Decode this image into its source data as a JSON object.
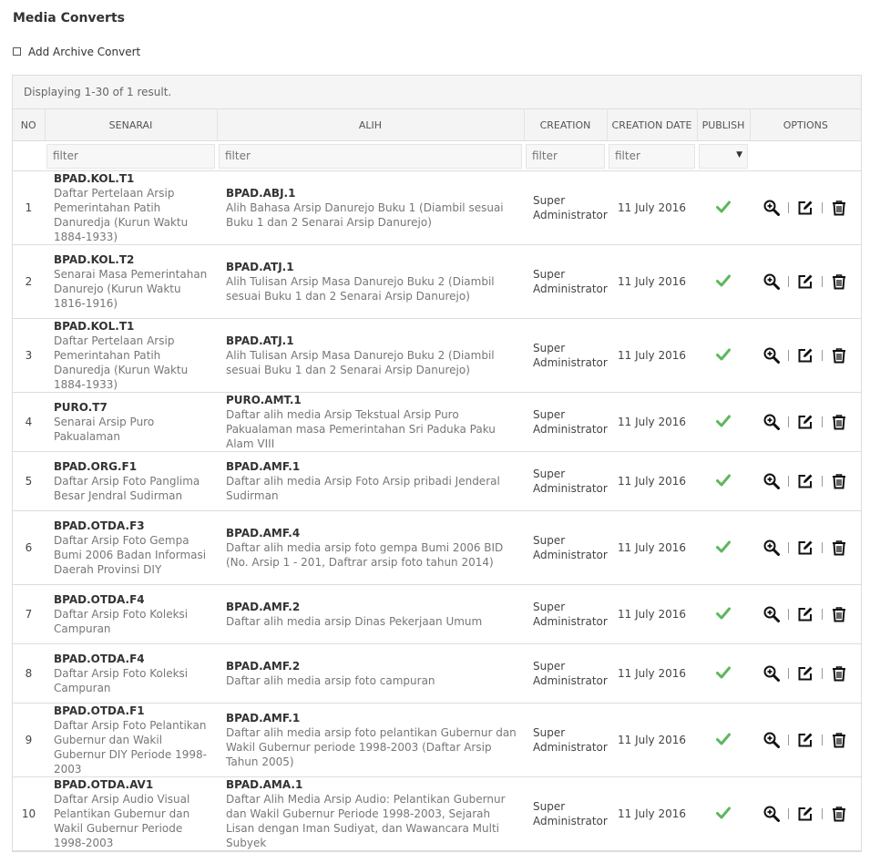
{
  "page": {
    "title": "Media Converts",
    "add_link": "Add Archive Convert"
  },
  "grid": {
    "summary": "Displaying 1-30 of 1 result.",
    "columns": [
      "NO",
      "SENARAI",
      "ALIH",
      "CREATION",
      "CREATION DATE",
      "PUBLISH",
      "OPTIONS"
    ],
    "filter_placeholder": "filter",
    "rows": [
      {
        "no": "1",
        "senarai_code": "BPAD.KOL.T1",
        "senarai_desc": "Daftar Pertelaan Arsip Pemerintahan Patih Danuredja (Kurun Waktu 1884-1933)",
        "alih_code": "BPAD.ABJ.1",
        "alih_desc": "Alih Bahasa Arsip Danurejo Buku 1 (Diambil sesuai Buku 1 dan 2 Senarai Arsip Danurejo)",
        "creation": "Super Administrator",
        "date": "11 July 2016"
      },
      {
        "no": "2",
        "senarai_code": "BPAD.KOL.T2",
        "senarai_desc": "Senarai Masa Pemerintahan Danurejo (Kurun Waktu 1816-1916)",
        "alih_code": "BPAD.ATJ.1",
        "alih_desc": "Alih Tulisan Arsip Masa Danurejo Buku 2 (Diambil sesuai Buku 1 dan 2 Senarai Arsip Danurejo)",
        "creation": "Super Administrator",
        "date": "11 July 2016"
      },
      {
        "no": "3",
        "senarai_code": "BPAD.KOL.T1",
        "senarai_desc": "Daftar Pertelaan Arsip Pemerintahan Patih Danuredja (Kurun Waktu 1884-1933)",
        "alih_code": "BPAD.ATJ.1",
        "alih_desc": "Alih Tulisan Arsip Masa Danurejo Buku 2 (Diambil sesuai Buku 1 dan 2 Senarai Arsip Danurejo)",
        "creation": "Super Administrator",
        "date": "11 July 2016"
      },
      {
        "no": "4",
        "senarai_code": "PURO.T7",
        "senarai_desc": "Senarai Arsip Puro Pakualaman",
        "alih_code": "PURO.AMT.1",
        "alih_desc": "Daftar alih media Arsip Tekstual Arsip Puro Pakualaman masa Pemerintahan Sri Paduka Paku Alam VIII",
        "creation": "Super Administrator",
        "date": "11 July 2016"
      },
      {
        "no": "5",
        "senarai_code": "BPAD.ORG.F1",
        "senarai_desc": "Daftar Arsip Foto Panglima Besar Jendral Sudirman",
        "alih_code": "BPAD.AMF.1",
        "alih_desc": "Daftar alih media Arsip Foto Arsip pribadi Jenderal Sudirman",
        "creation": "Super Administrator",
        "date": "11 July 2016"
      },
      {
        "no": "6",
        "senarai_code": "BPAD.OTDA.F3",
        "senarai_desc": "Daftar Arsip Foto Gempa Bumi 2006 Badan Informasi Daerah Provinsi DIY",
        "alih_code": "BPAD.AMF.4",
        "alih_desc": "Daftar alih media arsip foto gempa Bumi 2006 BID (No. Arsip 1 - 201, Daftrar arsip foto tahun 2014)",
        "creation": "Super Administrator",
        "date": "11 July 2016"
      },
      {
        "no": "7",
        "senarai_code": "BPAD.OTDA.F4",
        "senarai_desc": "Daftar Arsip Foto Koleksi Campuran",
        "alih_code": "BPAD.AMF.2",
        "alih_desc": "Daftar alih media arsip Dinas Pekerjaan Umum",
        "creation": "Super Administrator",
        "date": "11 July 2016"
      },
      {
        "no": "8",
        "senarai_code": "BPAD.OTDA.F4",
        "senarai_desc": "Daftar Arsip Foto Koleksi Campuran",
        "alih_code": "BPAD.AMF.2",
        "alih_desc": "Daftar alih media arsip foto campuran",
        "creation": "Super Administrator",
        "date": "11 July 2016"
      },
      {
        "no": "9",
        "senarai_code": "BPAD.OTDA.F1",
        "senarai_desc": "Daftar Arsip Foto Pelantikan Gubernur dan Wakil Gubernur DIY Periode 1998-2003",
        "alih_code": "BPAD.AMF.1",
        "alih_desc": "Daftar alih media arsip foto pelantikan Gubernur dan Wakil Gubernur periode 1998-2003 (Daftar Arsip Tahun 2005)",
        "creation": "Super Administrator",
        "date": "11 July 2016"
      },
      {
        "no": "10",
        "senarai_code": "BPAD.OTDA.AV1",
        "senarai_desc": "Daftar Arsip Audio Visual Pelantikan Gubernur dan Wakil Gubernur Periode 1998-2003",
        "alih_code": "BPAD.AMA.1",
        "alih_desc": "Daftar Alih Media Arsip Audio: Pelantikan Gubernur dan Wakil Gubernur Periode 1998-2003, Sejarah Lisan dengan Iman Sudiyat, dan Wawancara Multi Subyek",
        "creation": "Super Administrator",
        "date": "11 July 2016"
      }
    ]
  },
  "icons": {
    "publish": "check-icon",
    "view": "zoom-in-icon",
    "edit": "edit-icon",
    "delete": "trash-icon"
  },
  "colors": {
    "check": "#5cb85c",
    "header_bg": "#f4f4f4",
    "border": "#dddddd"
  }
}
